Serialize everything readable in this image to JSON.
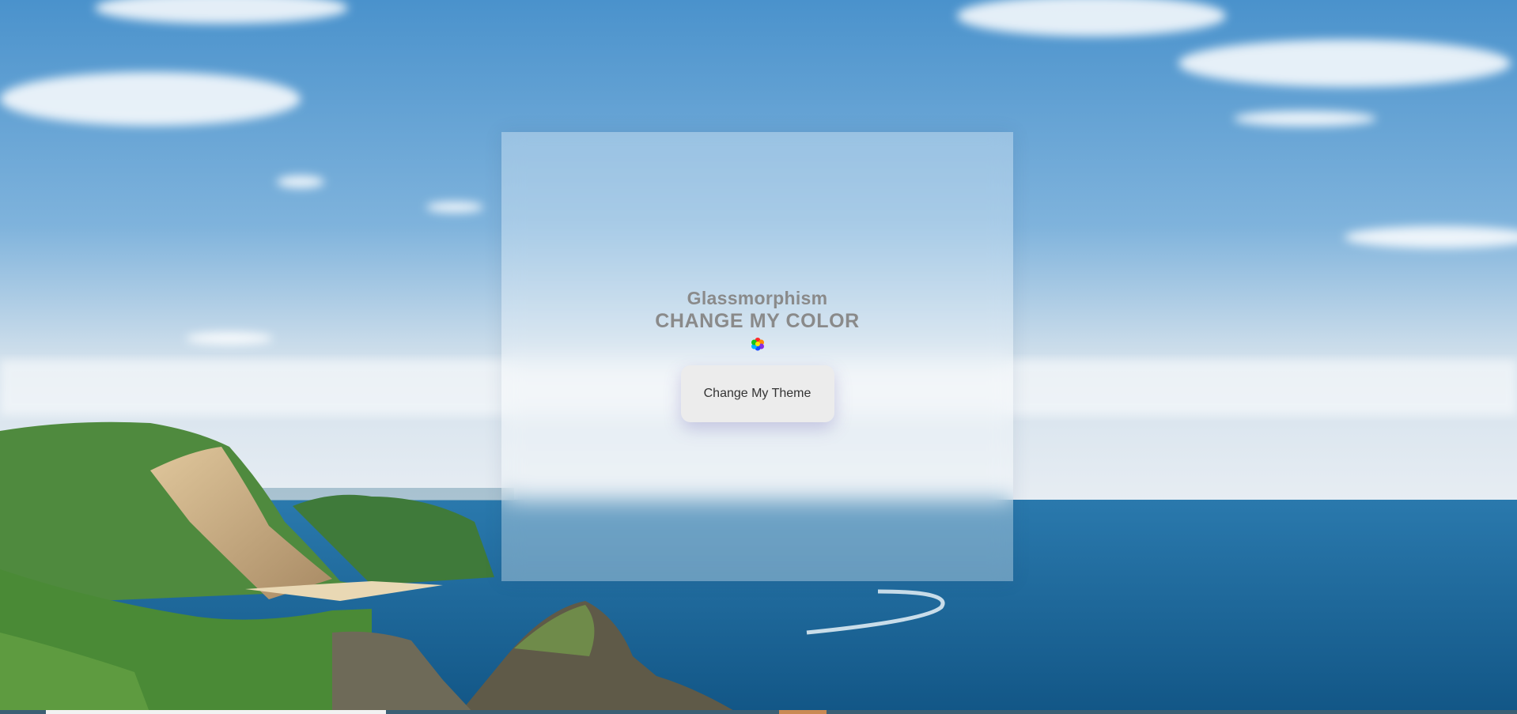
{
  "card": {
    "title": "Glassmorphism",
    "subtitle": "CHANGE MY COLOR",
    "button_label": "Change My Theme"
  },
  "icons": {
    "color_wheel": "color-wheel-icon"
  },
  "background": {
    "description_icon": "landscape-image",
    "sky_top": "#4f97cf",
    "sky_horizon": "#e6edf3",
    "sea": "#1f6a9f"
  }
}
